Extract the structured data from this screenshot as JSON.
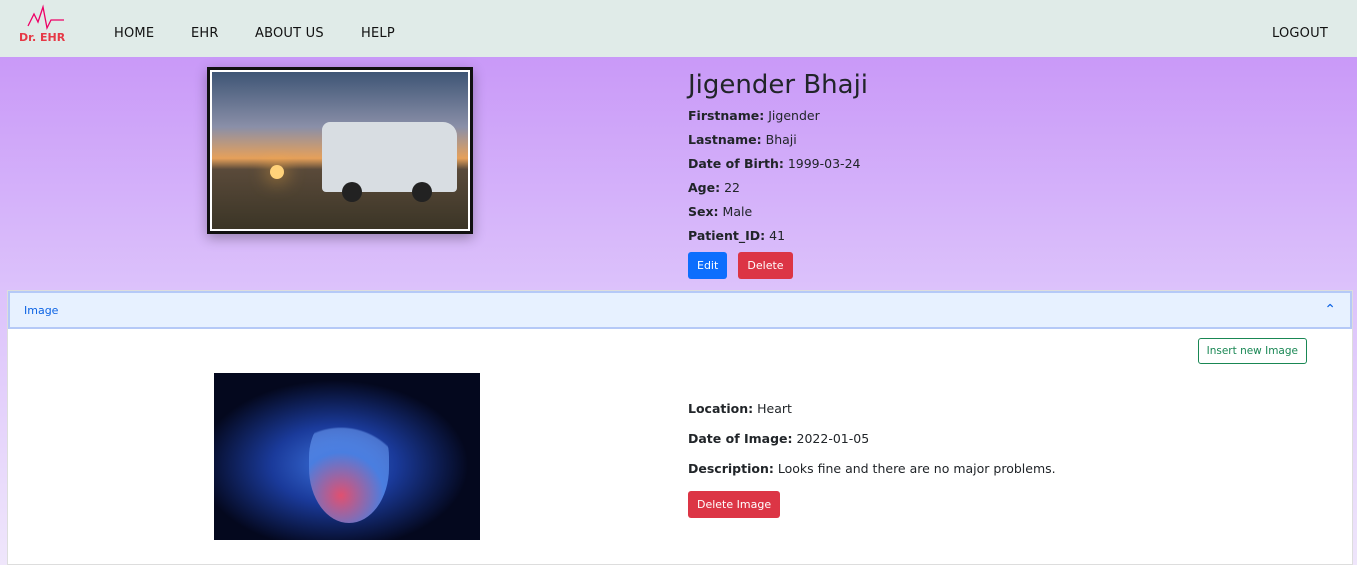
{
  "nav": {
    "logo_text": "Dr. EHR",
    "items": [
      "HOME",
      "EHR",
      "ABOUT US",
      "HELP"
    ],
    "logout": "LOGOUT"
  },
  "patient": {
    "full_name": "Jigender  Bhaji",
    "fields": [
      {
        "label": "Firstname:",
        "value": "Jigender"
      },
      {
        "label": "Lastname:",
        "value": "Bhaji"
      },
      {
        "label": "Date of Birth:",
        "value": "1999-03-24"
      },
      {
        "label": "Age:",
        "value": "22"
      },
      {
        "label": "Sex:",
        "value": "Male"
      },
      {
        "label": "Patient_ID:",
        "value": "41"
      }
    ],
    "edit": "Edit",
    "delete": "Delete"
  },
  "accordion": {
    "title": "Image",
    "insert": "Insert new Image",
    "image": {
      "fields": [
        {
          "label": "Location:",
          "value": "Heart"
        },
        {
          "label": "Date of Image:",
          "value": "2022-01-05"
        },
        {
          "label": "Description:",
          "value": "Looks fine and there are no major problems."
        }
      ],
      "delete": "Delete Image"
    }
  }
}
